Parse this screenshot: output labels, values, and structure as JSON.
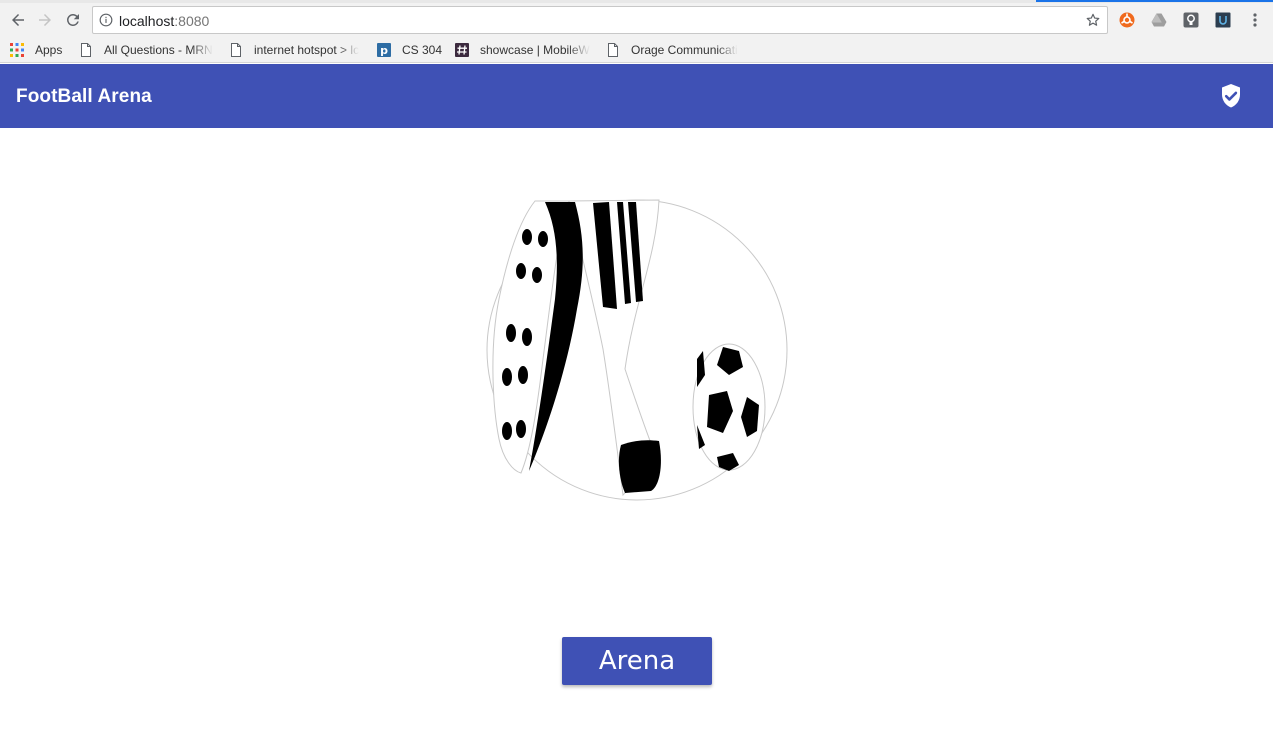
{
  "browser": {
    "url_host": "localhost",
    "url_port": ":8080",
    "icons": {
      "back": "back-arrow-icon",
      "forward": "forward-arrow-icon",
      "reload": "reload-icon",
      "info": "info-icon",
      "star": "star-icon",
      "menu": "more-vert-icon"
    },
    "bookmarks": [
      {
        "label": "Apps",
        "icon": "apps-grid-icon"
      },
      {
        "label": "All Questions - MRN",
        "icon": "page-icon"
      },
      {
        "label": "internet hotspot > lc",
        "icon": "page-icon"
      },
      {
        "label": "CS 304",
        "icon": "p-badge-icon"
      },
      {
        "label": "showcase | MobileW",
        "icon": "hash-icon"
      },
      {
        "label": "Orage Communicati",
        "icon": "page-icon"
      }
    ]
  },
  "app": {
    "title": "FootBall Arena",
    "header_icon": "verified-shield-icon",
    "hero_image": "football-player-kicking-ball-illustration",
    "button_label": "Arena",
    "colors": {
      "primary": "#3f51b5",
      "on_primary": "#ffffff",
      "background": "#ffffff"
    }
  }
}
